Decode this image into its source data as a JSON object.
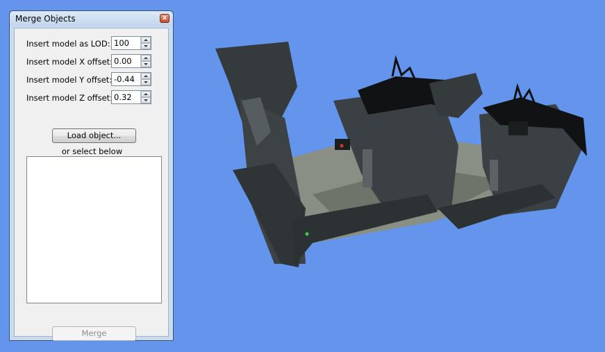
{
  "window": {
    "title": "Merge Objects",
    "close_glyph": "x"
  },
  "fields": [
    {
      "label": "Insert model as LOD:",
      "value": "100"
    },
    {
      "label": "Insert model X offset:",
      "value": "0.00"
    },
    {
      "label": "Insert model Y offset:",
      "value": "-0.44"
    },
    {
      "label": "Insert model Z offset:",
      "value": "0.32"
    }
  ],
  "load_button": "Load object...",
  "or_text": "or select below",
  "merge_button": "Merge",
  "object_list": [],
  "colors": {
    "viewport_background": "#6495ED",
    "model_body": "#3a4043",
    "model_floor": "#8a8f84"
  }
}
